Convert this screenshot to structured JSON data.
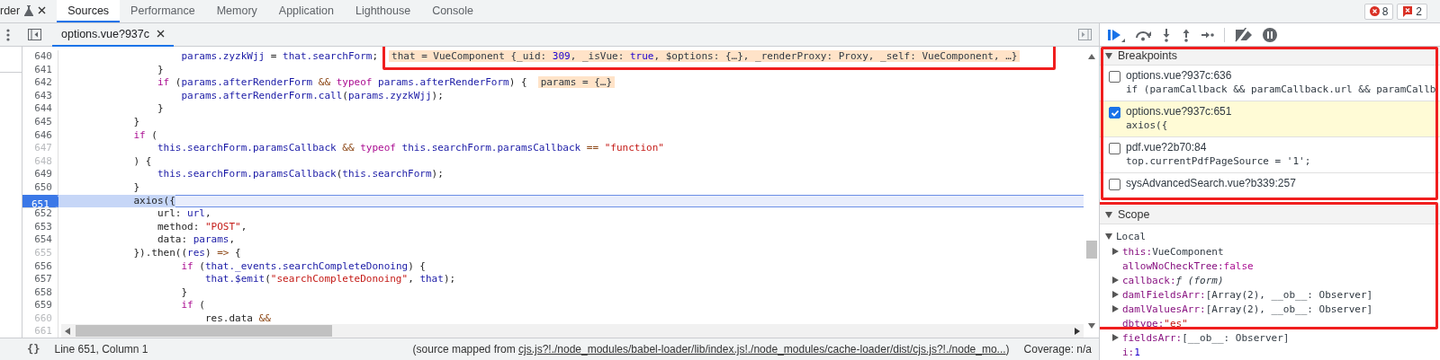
{
  "top_tabs": [
    {
      "label": "rder",
      "kind": "cut",
      "selected": false
    },
    {
      "label": "Sources",
      "selected": true
    },
    {
      "label": "Performance",
      "selected": false
    },
    {
      "label": "Memory",
      "selected": false
    },
    {
      "label": "Application",
      "selected": false
    },
    {
      "label": "Lighthouse",
      "selected": false
    },
    {
      "label": "Console",
      "selected": false
    }
  ],
  "counters": [
    {
      "kind": "error",
      "count": "8"
    },
    {
      "kind": "warning",
      "count": "2"
    }
  ],
  "file_tabs": [
    {
      "label": "options.vue?937c",
      "selected": true
    }
  ],
  "code": [
    {
      "number": "640",
      "dim": false,
      "current": false,
      "breakpoint": false,
      "tokens": [
        {
          "text": "                    params.zyzkWjj",
          "kind": "var"
        },
        {
          "text": " = ",
          "kind": "plain"
        },
        {
          "text": "that.searchForm",
          "kind": "var"
        },
        {
          "text": ";",
          "kind": "plain"
        }
      ],
      "inline": {
        "outlined": true,
        "tokens": [
          {
            "text": "that = VueComponent {_uid: ",
            "kind": "plain"
          },
          {
            "text": "309",
            "kind": "number"
          },
          {
            "text": ", _isVue: ",
            "kind": "plain"
          },
          {
            "text": "true",
            "kind": "number"
          },
          {
            "text": ", $options: {…}, _renderProxy: Proxy, _self: VueComponent, …}",
            "kind": "plain"
          }
        ]
      }
    },
    {
      "number": "641",
      "dim": false,
      "current": false,
      "breakpoint": false,
      "tokens": [
        {
          "text": "                }",
          "kind": "plain"
        }
      ]
    },
    {
      "number": "642",
      "dim": false,
      "current": false,
      "breakpoint": false,
      "tokens": [
        {
          "text": "                if",
          "kind": "keyword"
        },
        {
          "text": " (",
          "kind": "plain"
        },
        {
          "text": "params.afterRenderForm",
          "kind": "var"
        },
        {
          "text": " && ",
          "kind": "operator"
        },
        {
          "text": "typeof",
          "kind": "keyword"
        },
        {
          "text": " params.afterRenderForm",
          "kind": "var"
        },
        {
          "text": ") {",
          "kind": "plain"
        }
      ],
      "inline": {
        "outlined": false,
        "tokens": [
          {
            "text": "params = {…}",
            "kind": "plain"
          }
        ]
      }
    },
    {
      "number": "643",
      "dim": false,
      "current": false,
      "breakpoint": false,
      "tokens": [
        {
          "text": "                    params.afterRenderForm.call",
          "kind": "var"
        },
        {
          "text": "(",
          "kind": "plain"
        },
        {
          "text": "params.zyzkWjj",
          "kind": "var"
        },
        {
          "text": ");",
          "kind": "plain"
        }
      ]
    },
    {
      "number": "644",
      "dim": false,
      "current": false,
      "breakpoint": false,
      "tokens": [
        {
          "text": "                }",
          "kind": "plain"
        }
      ]
    },
    {
      "number": "645",
      "dim": false,
      "current": false,
      "breakpoint": false,
      "tokens": [
        {
          "text": "            }",
          "kind": "plain"
        }
      ]
    },
    {
      "number": "646",
      "dim": false,
      "current": false,
      "breakpoint": false,
      "tokens": [
        {
          "text": "            if",
          "kind": "keyword"
        },
        {
          "text": " (",
          "kind": "plain"
        }
      ]
    },
    {
      "number": "647",
      "dim": true,
      "current": false,
      "breakpoint": false,
      "tokens": [
        {
          "text": "                this.searchForm.paramsCallback",
          "kind": "var"
        },
        {
          "text": " && ",
          "kind": "operator"
        },
        {
          "text": "typeof",
          "kind": "keyword"
        },
        {
          "text": " this.searchForm.paramsCallback",
          "kind": "var"
        },
        {
          "text": " == ",
          "kind": "operator"
        },
        {
          "text": "\"function\"",
          "kind": "string"
        }
      ]
    },
    {
      "number": "648",
      "dim": true,
      "current": false,
      "breakpoint": false,
      "tokens": [
        {
          "text": "            ) {",
          "kind": "plain"
        }
      ]
    },
    {
      "number": "649",
      "dim": false,
      "current": false,
      "breakpoint": false,
      "tokens": [
        {
          "text": "                this.searchForm.paramsCallback",
          "kind": "var"
        },
        {
          "text": "(",
          "kind": "plain"
        },
        {
          "text": "this.searchForm",
          "kind": "var"
        },
        {
          "text": ");",
          "kind": "plain"
        }
      ]
    },
    {
      "number": "650",
      "dim": false,
      "current": false,
      "breakpoint": false,
      "tokens": [
        {
          "text": "            }",
          "kind": "plain"
        }
      ]
    },
    {
      "number": "651",
      "dim": false,
      "current": true,
      "breakpoint": true,
      "tokens": [
        {
          "text": "            axios({",
          "kind": "plain"
        }
      ]
    },
    {
      "number": "652",
      "dim": false,
      "current": false,
      "breakpoint": false,
      "tokens": [
        {
          "text": "                url: ",
          "kind": "plain"
        },
        {
          "text": "url",
          "kind": "var"
        },
        {
          "text": ",",
          "kind": "plain"
        }
      ]
    },
    {
      "number": "653",
      "dim": false,
      "current": false,
      "breakpoint": false,
      "tokens": [
        {
          "text": "                method: ",
          "kind": "plain"
        },
        {
          "text": "\"POST\"",
          "kind": "string"
        },
        {
          "text": ",",
          "kind": "plain"
        }
      ]
    },
    {
      "number": "654",
      "dim": false,
      "current": false,
      "breakpoint": false,
      "tokens": [
        {
          "text": "                data: ",
          "kind": "plain"
        },
        {
          "text": "params",
          "kind": "var"
        },
        {
          "text": ",",
          "kind": "plain"
        }
      ]
    },
    {
      "number": "655",
      "dim": true,
      "current": false,
      "breakpoint": false,
      "tokens": [
        {
          "text": "            }).then((",
          "kind": "plain"
        },
        {
          "text": "res",
          "kind": "var"
        },
        {
          "text": ") ",
          "kind": "plain"
        },
        {
          "text": "=>",
          "kind": "operator"
        },
        {
          "text": " {",
          "kind": "plain"
        }
      ]
    },
    {
      "number": "656",
      "dim": false,
      "current": false,
      "breakpoint": false,
      "tokens": [
        {
          "text": "                    if",
          "kind": "keyword"
        },
        {
          "text": " (",
          "kind": "plain"
        },
        {
          "text": "that._events.searchCompleteDonoing",
          "kind": "var"
        },
        {
          "text": ") {",
          "kind": "plain"
        }
      ]
    },
    {
      "number": "657",
      "dim": false,
      "current": false,
      "breakpoint": false,
      "tokens": [
        {
          "text": "                        that.$emit",
          "kind": "var"
        },
        {
          "text": "(",
          "kind": "plain"
        },
        {
          "text": "\"searchCompleteDonoing\"",
          "kind": "string"
        },
        {
          "text": ", ",
          "kind": "plain"
        },
        {
          "text": "that",
          "kind": "var"
        },
        {
          "text": ");",
          "kind": "plain"
        }
      ]
    },
    {
      "number": "658",
      "dim": false,
      "current": false,
      "breakpoint": false,
      "tokens": [
        {
          "text": "                    }",
          "kind": "plain"
        }
      ]
    },
    {
      "number": "659",
      "dim": false,
      "current": false,
      "breakpoint": false,
      "tokens": [
        {
          "text": "                    if",
          "kind": "keyword"
        },
        {
          "text": " (",
          "kind": "plain"
        }
      ]
    },
    {
      "number": "660",
      "dim": true,
      "current": false,
      "breakpoint": false,
      "tokens": [
        {
          "text": "                        res.data",
          "kind": "plain"
        },
        {
          "text": " &&",
          "kind": "operator"
        }
      ]
    },
    {
      "number": "661",
      "dim": true,
      "current": false,
      "breakpoint": false
    }
  ],
  "status_bar": {
    "format_button": "{}",
    "position": "Line 651, Column 1",
    "source_prefix": "(source mapped from ",
    "source_link": "cjs.js?!./node_modules/babel-loader/lib/index.js!./node_modules/cache-loader/dist/cjs.js?!./node_mo...",
    "source_suffix": ")",
    "coverage": "Coverage: n/a"
  },
  "breakpoints": {
    "title": "Breakpoints",
    "expanded": true,
    "outlined": true,
    "items": [
      {
        "location": "options.vue?937c:636",
        "code": "if (paramCallback && paramCallback.url && paramCallb",
        "checked": false,
        "selected": false
      },
      {
        "location": "options.vue?937c:651",
        "code": "axios({",
        "checked": true,
        "selected": true
      },
      {
        "location": "pdf.vue?2b70:84",
        "code": "top.currentPdfPageSource = '1';",
        "checked": false,
        "selected": false
      },
      {
        "location": "sysAdvancedSearch.vue?b339:257",
        "checked": false,
        "selected": false
      }
    ]
  },
  "scope": {
    "title": "Scope",
    "expanded": true,
    "outlined": true,
    "groups": [
      {
        "name": "Local",
        "expanded": true,
        "children": [
          {
            "name": "this:",
            "value": "VueComponent",
            "kind": "object",
            "expanded": false
          },
          {
            "name": "allowNoCheckTree:",
            "value": "false",
            "kind": "boolean"
          },
          {
            "name": "callback:",
            "value": "ƒ (form)",
            "kind": "function",
            "expanded": false
          },
          {
            "name": "damlFieldsArr:",
            "value": "[Array(2), __ob__: Observer]",
            "kind": "object",
            "expanded": false
          },
          {
            "name": "damlValuesArr:",
            "value": "[Array(2), __ob__: Observer]",
            "kind": "object",
            "expanded": false
          },
          {
            "name": "dbtype:",
            "value": "\"es\"",
            "kind": "string"
          },
          {
            "name": "fieldsArr:",
            "value": "[__ob__: Observer]",
            "kind": "object",
            "expanded": false
          },
          {
            "name": "i:",
            "value": "1",
            "kind": "number"
          }
        ]
      }
    ]
  }
}
